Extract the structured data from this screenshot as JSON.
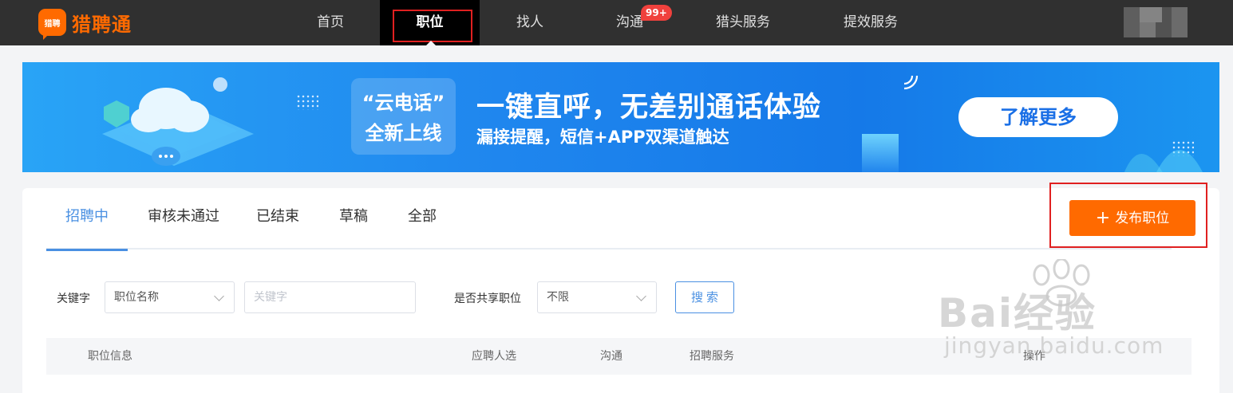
{
  "app": {
    "logo_badge": "猎聘",
    "name": "猎聘通"
  },
  "nav": {
    "items": [
      "首页",
      "职位",
      "找人",
      "沟通",
      "猎头服务",
      "提效服务"
    ],
    "active": "职位",
    "chat_badge": "99+"
  },
  "banner": {
    "tag_line1": "“云电话”",
    "tag_line2": "全新上线",
    "title": "一键直呼，无差别通话体验",
    "subtitle": "漏接提醒，短信+APP双渠道触达",
    "button": "了解更多"
  },
  "tabs": [
    "招聘中",
    "审核未通过",
    "已结束",
    "草稿",
    "全部"
  ],
  "active_tab": "招聘中",
  "publish_button": "发布职位",
  "filters": {
    "keyword_label": "关键字",
    "keyword_type_value": "职位名称",
    "keyword_placeholder": "关键字",
    "shared_label": "是否共享职位",
    "shared_value": "不限",
    "search_button": "搜索"
  },
  "table": {
    "columns": [
      "职位信息",
      "应聘人选",
      "沟通",
      "招聘服务",
      "操作"
    ]
  },
  "watermark": {
    "brand": "Bai经验",
    "url": "jingyan.baidu.com"
  },
  "colors": {
    "accent": "#ff6a00",
    "link": "#4a90e2",
    "nav_bg": "#303030",
    "highlight": "#e02020"
  }
}
